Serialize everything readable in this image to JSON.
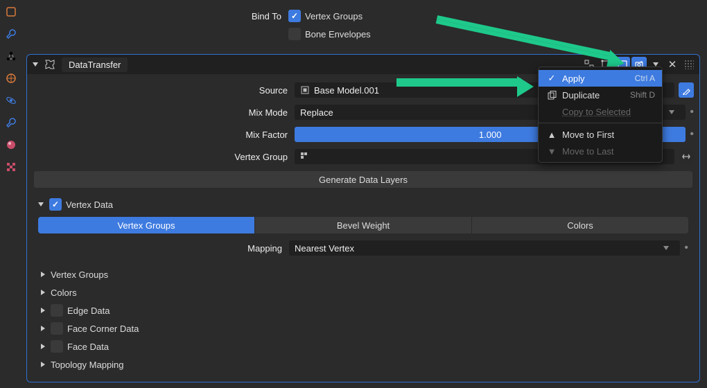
{
  "bind_to": {
    "label": "Bind To",
    "vertex_groups": "Vertex Groups",
    "bone_envelopes": "Bone Envelopes"
  },
  "modifier": {
    "name": "DataTransfer"
  },
  "source": {
    "label": "Source",
    "value": "Base Model.001"
  },
  "mix_mode": {
    "label": "Mix Mode",
    "value": "Replace"
  },
  "mix_factor": {
    "label": "Mix Factor",
    "value": "1.000"
  },
  "vertex_group_row": {
    "label": "Vertex Group"
  },
  "generate_btn": "Generate Data Layers",
  "vertex_data": {
    "header": "Vertex Data",
    "tabs": {
      "vg": "Vertex Groups",
      "bw": "Bevel Weight",
      "col": "Colors"
    },
    "mapping": {
      "label": "Mapping",
      "value": "Nearest Vertex"
    }
  },
  "list": {
    "vg": "Vertex Groups",
    "colors": "Colors",
    "edge": "Edge Data",
    "facecorner": "Face Corner Data",
    "face": "Face Data",
    "topo": "Topology Mapping"
  },
  "menu": {
    "apply": "Apply",
    "apply_sc": "Ctrl A",
    "duplicate": "Duplicate",
    "duplicate_sc": "Shift D",
    "copy": "Copy to Selected",
    "first": "Move to First",
    "last": "Move to Last"
  }
}
